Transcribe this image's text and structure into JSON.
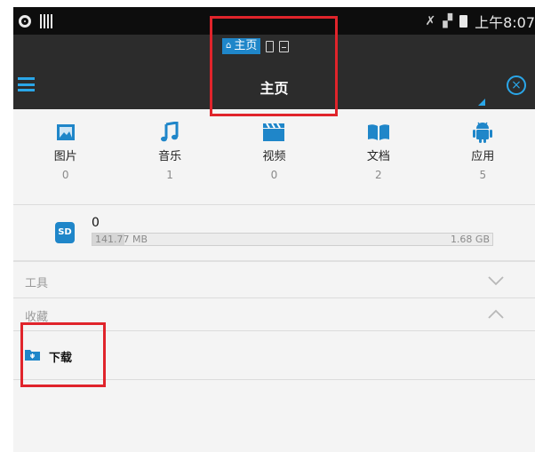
{
  "status_bar": {
    "time": "上午8:07",
    "icons": [
      "screen-record-icon",
      "barcode-icon",
      "mute-icon",
      "no-sim-signal-icon",
      "battery-icon"
    ]
  },
  "app_bar": {
    "mini_tabs": [
      {
        "label": "主页",
        "icon": "home-icon",
        "selected": true
      },
      {
        "label": "",
        "icon": "phone-storage-icon",
        "selected": false
      },
      {
        "label": "",
        "icon": "sd-storage-icon",
        "selected": false
      }
    ],
    "title": "主页"
  },
  "categories": [
    {
      "label": "图片",
      "count": "0",
      "icon": "image-icon"
    },
    {
      "label": "音乐",
      "count": "1",
      "icon": "music-note-icon"
    },
    {
      "label": "视频",
      "count": "0",
      "icon": "clapperboard-icon"
    },
    {
      "label": "文档",
      "count": "2",
      "icon": "book-icon"
    },
    {
      "label": "应用",
      "count": "5",
      "icon": "android-icon"
    }
  ],
  "storage": {
    "badge": "SD",
    "name": "0",
    "used": "141.77 MB",
    "total": "1.68 GB",
    "used_fraction": 0.08
  },
  "sections": {
    "tools": {
      "label": "工具",
      "expanded": false
    },
    "favorites": {
      "label": "收藏",
      "expanded": true
    }
  },
  "favorites": [
    {
      "label": "下载",
      "icon": "download-folder-icon"
    }
  ],
  "colors": {
    "accent": "#1f86c9",
    "app_bar": "#2c2c2c",
    "status_bar": "#0d0d0d",
    "annotation": "#e0242b"
  }
}
